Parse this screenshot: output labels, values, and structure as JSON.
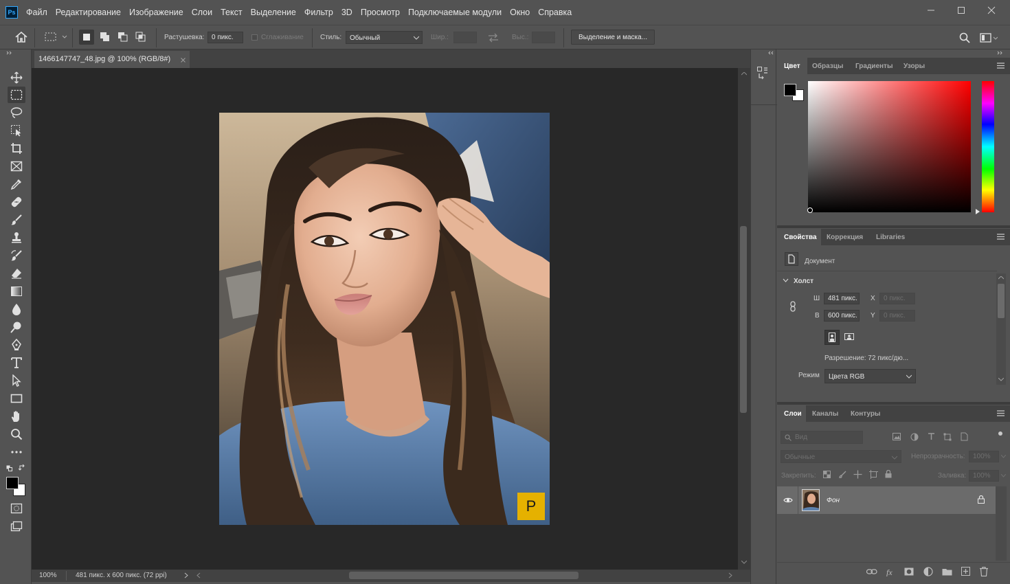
{
  "app": {
    "logo": "Ps"
  },
  "menu": [
    "Файл",
    "Редактирование",
    "Изображение",
    "Слои",
    "Текст",
    "Выделение",
    "Фильтр",
    "3D",
    "Просмотр",
    "Подключаемые модули",
    "Окно",
    "Справка"
  ],
  "options": {
    "feather_label": "Растушевка:",
    "feather_value": "0 пикс.",
    "antialias_label": "Сглаживание",
    "style_label": "Стиль:",
    "style_value": "Обычный",
    "width_label": "Шир.:",
    "height_label": "Выс.:",
    "select_mask_label": "Выделение и маска..."
  },
  "document": {
    "tab_title": "1466147747_48.jpg @ 100% (RGB/8#)",
    "watermark": "P"
  },
  "status": {
    "zoom": "100%",
    "info": "481 пикс. x 600 пикс. (72 ppi)"
  },
  "color_panel": {
    "tabs": [
      "Цвет",
      "Образцы",
      "Градиенты",
      "Узоры"
    ],
    "foreground": "#000000",
    "background": "#ffffff",
    "hue": "#ff0000"
  },
  "properties_panel": {
    "tabs": [
      "Свойства",
      "Коррекция",
      "Libraries"
    ],
    "doc_label": "Документ",
    "section": "Холст",
    "w_label": "Ш",
    "w_value": "481 пикс.",
    "h_label": "В",
    "h_value": "600 пикс.",
    "x_label": "X",
    "x_placeholder": "0 пикс.",
    "y_label": "Y",
    "y_placeholder": "0 пикс.",
    "resolution": "Разрешение: 72 пикс/дю...",
    "mode_label": "Режим",
    "mode_value": "Цвета RGB"
  },
  "layers_panel": {
    "tabs": [
      "Слои",
      "Каналы",
      "Контуры"
    ],
    "filter_placeholder": "Вид",
    "blend_mode": "Обычные",
    "opacity_label": "Непрозрачность:",
    "opacity_value": "100%",
    "lock_label": "Закрепить:",
    "fill_label": "Заливка:",
    "fill_value": "100%",
    "layers": [
      {
        "name": "Фон",
        "visible": true,
        "locked": true
      }
    ]
  },
  "colors": {
    "accent": "#31a8ff",
    "watermark_bg": "#e5b100"
  }
}
